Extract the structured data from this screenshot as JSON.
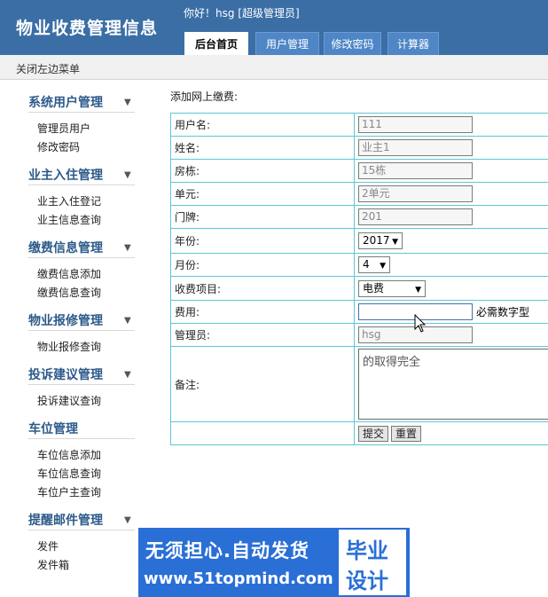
{
  "header": {
    "app_title": "物业收费管理信息",
    "greeting": "你好！hsg [超级管理员]",
    "tabs": [
      {
        "label": "后台首页",
        "active": true
      },
      {
        "label": "用户管理",
        "active": false
      },
      {
        "label": "修改密码",
        "active": false
      },
      {
        "label": "计算器",
        "active": false
      }
    ]
  },
  "toolbar": {
    "close_menu": "关闭左边菜单"
  },
  "sidebar": {
    "groups": [
      {
        "title": "系统用户管理",
        "items": [
          "管理员用户",
          "修改密码"
        ]
      },
      {
        "title": "业主入住管理",
        "items": [
          "业主入住登记",
          "业主信息查询"
        ]
      },
      {
        "title": "缴费信息管理",
        "items": [
          "缴费信息添加",
          "缴费信息查询"
        ]
      },
      {
        "title": "物业报修管理",
        "items": [
          "物业报修查询"
        ]
      },
      {
        "title": "投诉建议管理",
        "items": [
          "投诉建议查询"
        ]
      },
      {
        "title": "车位管理",
        "items": [
          "车位信息添加",
          "车位信息查询",
          "车位户主查询"
        ]
      },
      {
        "title": "提醒邮件管理",
        "items": [
          "发件",
          "发件箱"
        ]
      }
    ]
  },
  "form": {
    "caption": "添加网上缴费:",
    "fields": {
      "username": {
        "label": "用户名:",
        "value": "111"
      },
      "name": {
        "label": "姓名:",
        "value": "业主1"
      },
      "building": {
        "label": "房栋:",
        "value": "15栋"
      },
      "unit": {
        "label": "单元:",
        "value": "2单元"
      },
      "door": {
        "label": "门牌:",
        "value": "201"
      },
      "year": {
        "label": "年份:",
        "value": "2017"
      },
      "month": {
        "label": "月份:",
        "value": "4"
      },
      "item": {
        "label": "收费项目:",
        "value": "电费"
      },
      "fee": {
        "label": "费用:",
        "value": "",
        "hint": "必需数字型"
      },
      "admin": {
        "label": "管理员:",
        "value": "hsg"
      },
      "remark": {
        "label": "备注:",
        "value": "的取得完全"
      }
    },
    "buttons": {
      "submit": "提交",
      "reset": "重置"
    }
  },
  "watermark": {
    "line1": "无须担心.自动发货",
    "line2": "www.51topmind.com",
    "box_line1": "毕业",
    "box_line2": "设计"
  },
  "colors": {
    "header_bg": "#3a6ea5",
    "sidebar_title": "#2c5a8a",
    "table_border": "#5bc8d6",
    "banner_bg": "#2a6fd6"
  }
}
